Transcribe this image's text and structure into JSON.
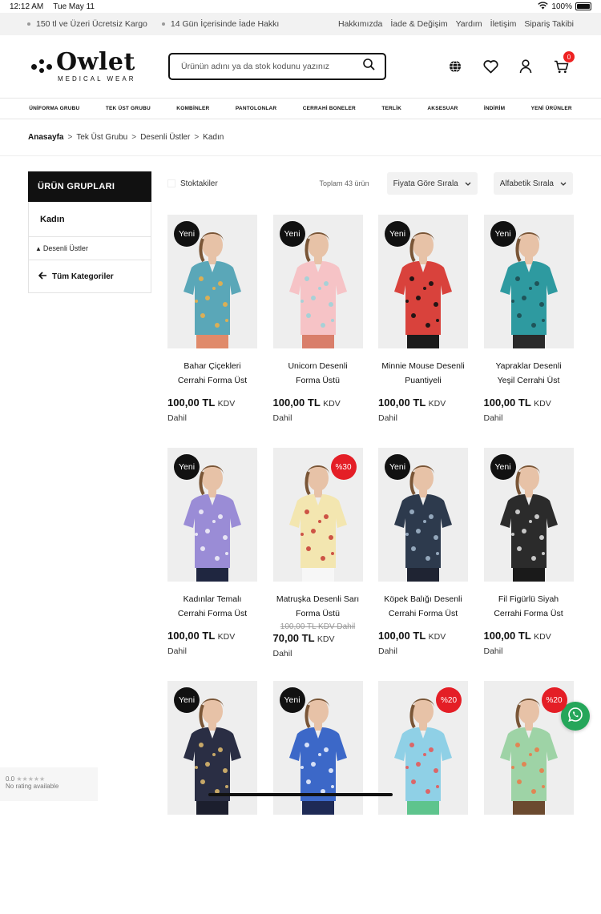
{
  "status": {
    "time": "12:12 AM",
    "date": "Tue May 11",
    "battery": "100%"
  },
  "infobar": {
    "perks": [
      "150 tl ve Üzeri Ücretsiz Kargo",
      "14 Gün İçerisinde İade Hakkı"
    ],
    "links": [
      "Hakkımızda",
      "İade & Değişim",
      "Yardım",
      "İletişim",
      "Sipariş Takibi"
    ]
  },
  "header": {
    "brand": "Owlet",
    "brand_sub": "MEDICAL WEAR",
    "search_placeholder": "Ürünün adını ya da stok kodunu yazınız",
    "cart_count": "0"
  },
  "nav": [
    "ÜNİFORMA GRUBU",
    "TEK ÜST GRUBU",
    "KOMBİNLER",
    "PANTOLONLAR",
    "CERRAHİ BONELER",
    "TERLİK",
    "AKSESUAR",
    "İNDİRİM",
    "YENİ ÜRÜNLER"
  ],
  "breadcrumb": [
    "Anasayfa",
    "Tek Üst Grubu",
    "Desenli Üstler",
    "Kadın"
  ],
  "sidebar": {
    "title": "ÜRÜN GRUPLARI",
    "category": "Kadın",
    "sub": "Desenli Üstler",
    "back": "Tüm Kategoriler"
  },
  "toolbar": {
    "stock": "Stoktakiler",
    "total": "Toplam 43 ürün",
    "sort_price": "Fiyata Göre Sırala",
    "sort_alpha": "Alfabetik Sırala"
  },
  "products": [
    {
      "name": "Bahar Çiçekleri Cerrahi Forma Üst",
      "badge": "Yeni",
      "price": "100,00 TL",
      "kdv": "KDV",
      "dahil": "Dahil",
      "old": "",
      "color": "#5aa7b8",
      "pattern": "#e8b04c",
      "pants": "#e08a6a"
    },
    {
      "name": "Unicorn Desenli Forma Üstü",
      "badge": "Yeni",
      "price": "100,00 TL",
      "kdv": "KDV",
      "dahil": "Dahil",
      "old": "",
      "color": "#f6c3c6",
      "pattern": "#9fd3d9",
      "pants": "#d97e6a"
    },
    {
      "name": "Minnie Mouse Desenli Puantiyeli",
      "badge": "Yeni",
      "price": "100,00 TL",
      "kdv": "KDV",
      "dahil": "Dahil",
      "old": "",
      "color": "#d9423c",
      "pattern": "#111111",
      "pants": "#1b1b1b"
    },
    {
      "name": "Yapraklar Desenli Yeşil Cerrahi Üst",
      "badge": "Yeni",
      "price": "100,00 TL",
      "kdv": "KDV",
      "dahil": "Dahil",
      "old": "",
      "color": "#2e9aa0",
      "pattern": "#1e4d52",
      "pants": "#2a2a2a"
    },
    {
      "name": "Kadınlar Temalı Cerrahi Forma Üst",
      "badge": "Yeni",
      "price": "100,00 TL",
      "kdv": "KDV",
      "dahil": "Dahil",
      "old": "",
      "color": "#9a8cd6",
      "pattern": "#f0eef8",
      "pants": "#1f2640"
    },
    {
      "name": "Matruşka Desenli Sarı Forma Üstü",
      "badge": "%30",
      "price": "70,00 TL",
      "kdv": "KDV",
      "dahil": "Dahil",
      "old": "100,00 TL KDV Dahil",
      "color": "#f3e6b0",
      "pattern": "#c9443a",
      "pants": "#f7f7f7"
    },
    {
      "name": "Köpek Balığı Desenli Cerrahi Forma Üst",
      "badge": "Yeni",
      "price": "100,00 TL",
      "kdv": "KDV",
      "dahil": "Dahil",
      "old": "",
      "color": "#2d3a4d",
      "pattern": "#9fb3c8",
      "pants": "#1f2433"
    },
    {
      "name": "Fil Figürlü Siyah Cerrahi Forma Üst",
      "badge": "Yeni",
      "price": "100,00 TL",
      "kdv": "KDV",
      "dahil": "Dahil",
      "old": "",
      "color": "#2b2b2b",
      "pattern": "#d8d8d8",
      "pants": "#1a1a1a"
    },
    {
      "name": "",
      "badge": "Yeni",
      "price": "",
      "kdv": "",
      "dahil": "",
      "old": "",
      "color": "#2a2e44",
      "pattern": "#d9b66c",
      "pants": "#1c1f2e"
    },
    {
      "name": "",
      "badge": "Yeni",
      "price": "",
      "kdv": "",
      "dahil": "",
      "old": "",
      "color": "#3c68c8",
      "pattern": "#e8eefc",
      "pants": "#1e2a55"
    },
    {
      "name": "",
      "badge": "%20",
      "price": "",
      "kdv": "",
      "dahil": "",
      "old": "",
      "color": "#8fd0e6",
      "pattern": "#e45b5b",
      "pants": "#5ec48d"
    },
    {
      "name": "",
      "badge": "%20",
      "price": "",
      "kdv": "",
      "dahil": "",
      "old": "",
      "color": "#9ed3a6",
      "pattern": "#e87e4c",
      "pants": "#6b4a2f"
    }
  ],
  "rating": {
    "score": "0.0",
    "text": "No rating available"
  },
  "colors": {
    "sale_badge": "#e41e26",
    "new_badge": "#111111",
    "whatsapp": "#25a65a"
  }
}
